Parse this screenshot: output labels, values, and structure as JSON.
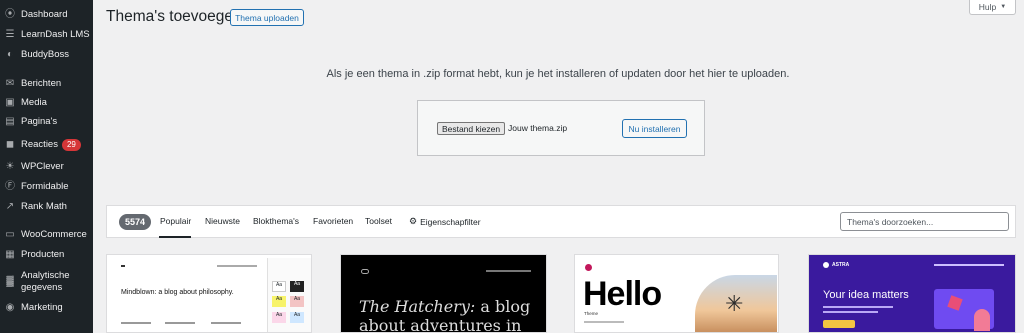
{
  "sidebar": {
    "items": [
      {
        "label": "Dashboard",
        "icon": "dashboard-icon",
        "glyph": "⦿"
      },
      {
        "label": "LearnDash LMS",
        "icon": "learndash-icon",
        "glyph": "☰"
      },
      {
        "label": "BuddyBoss",
        "icon": "buddyboss-icon",
        "glyph": "◐"
      },
      {
        "label": "Berichten",
        "icon": "pin-icon",
        "glyph": "✉"
      },
      {
        "label": "Media",
        "icon": "media-icon",
        "glyph": "▣"
      },
      {
        "label": "Pagina's",
        "icon": "page-icon",
        "glyph": "▤"
      },
      {
        "label": "Reacties",
        "icon": "comment-icon",
        "glyph": "◼",
        "badge": "29"
      },
      {
        "label": "WPClever",
        "icon": "wpclever-icon",
        "glyph": "☀"
      },
      {
        "label": "Formidable",
        "icon": "formidable-icon",
        "glyph": "Ⓕ"
      },
      {
        "label": "Rank Math",
        "icon": "rankmath-icon",
        "glyph": "↗"
      },
      {
        "label": "WooCommerce",
        "icon": "woocommerce-icon",
        "glyph": "▭"
      },
      {
        "label": "Producten",
        "icon": "products-icon",
        "glyph": "▦"
      },
      {
        "label": "Analytische gegevens",
        "icon": "analytics-icon",
        "glyph": "▓"
      },
      {
        "label": "Marketing",
        "icon": "marketing-icon",
        "glyph": "◉"
      }
    ]
  },
  "help": {
    "label": "Hulp",
    "arrow": "▼"
  },
  "header": {
    "title": "Thema's toevoegen",
    "upload_label": "Thema uploaden"
  },
  "upload": {
    "description": "Als je een thema in .zip format hebt, kun je het installeren of updaten door het hier te uploaden.",
    "choose_file_label": "Bestand kiezen",
    "file_name": "Jouw thema.zip",
    "install_label": "Nu installeren"
  },
  "filter": {
    "count": "5574",
    "tabs": [
      "Populair",
      "Nieuwste",
      "Blokthema's",
      "Favorieten",
      "Toolset"
    ],
    "feature_filter": "Eigenschapfilter",
    "search_placeholder": "Thema's doorzoeken..."
  },
  "themes": {
    "card1": {
      "tagline": "Mindblown: a blog about philosophy."
    },
    "card2": {
      "tagline_italic": "The Hatchery:",
      "tagline_rest": "a blog about adventures in"
    },
    "card3": {
      "title": "Hello",
      "sub": "Theme"
    },
    "card4": {
      "brand": "ASTRA",
      "headline": "Your idea matters"
    }
  },
  "colors": {
    "sidebar_bg": "#1d2327",
    "accent": "#2271b1",
    "badge": "#d63638",
    "astra_bg": "#3a1a9e"
  }
}
